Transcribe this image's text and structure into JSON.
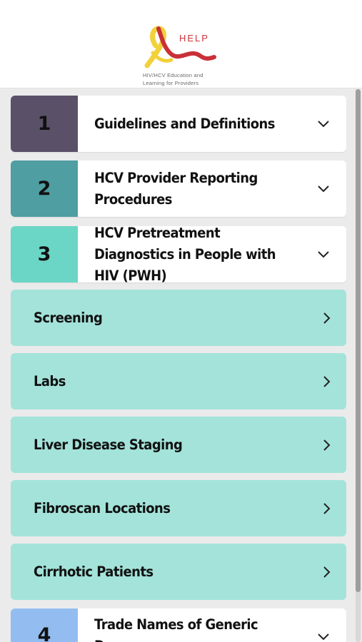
{
  "logo": {
    "name": "HELP",
    "tagline": "HIV/HCV Education and Learning for Providers"
  },
  "colors": {
    "section1": "#5a5068",
    "section2": "#4e9ea2",
    "section3": "#6bd6c5",
    "section4": "#93bdf0",
    "subitem": "#a3e3da"
  },
  "sections": [
    {
      "number": "1",
      "title": "Guidelines and Definitions",
      "icon": "chevron-down-icon"
    },
    {
      "number": "2",
      "title": "HCV Provider Reporting Procedures",
      "icon": "chevron-down-icon"
    },
    {
      "number": "3",
      "title": "HCV Pretreatment Diagnostics in People with HIV (PWH)",
      "icon": "chevron-down-icon"
    },
    {
      "number": "4",
      "title": "Trade Names of Generic Drugs",
      "icon": "chevron-down-icon"
    }
  ],
  "subitems": [
    {
      "label": "Screening",
      "icon": "chevron-right-icon"
    },
    {
      "label": "Labs",
      "icon": "chevron-right-icon"
    },
    {
      "label": "Liver Disease Staging",
      "icon": "chevron-right-icon"
    },
    {
      "label": "Fibroscan Locations",
      "icon": "chevron-right-icon"
    },
    {
      "label": "Cirrhotic Patients",
      "icon": "chevron-right-icon"
    }
  ]
}
